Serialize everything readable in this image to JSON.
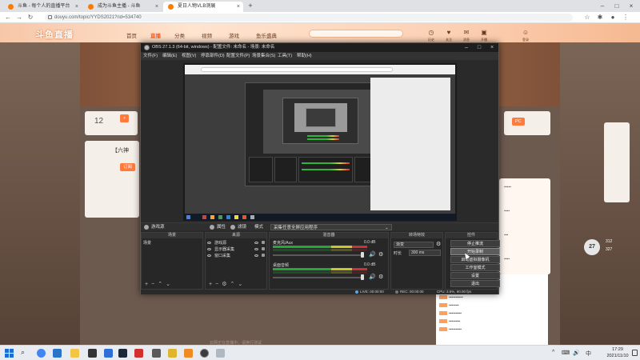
{
  "browser": {
    "tabs": [
      {
        "label": "斗鱼 - 每个人的直播平台"
      },
      {
        "label": "成为斗鱼主播 - 斗鱼"
      },
      {
        "label": "夏日人物VLB测展"
      }
    ],
    "url": "douyu.com/topic/YYDS2021?rid=534740"
  },
  "site": {
    "logo": "斗鱼直播",
    "nav": [
      "首页",
      "直播",
      "分类",
      "视频",
      "游戏",
      "鱼乐盛典"
    ],
    "header_icons": [
      "历史",
      "关注",
      "消息",
      "开播",
      "登录"
    ]
  },
  "page": {
    "streamer_count": "12",
    "streamer_name": "【六神",
    "left_chip": "订阅",
    "side_number": "27",
    "side_stats": [
      "312",
      "327"
    ],
    "below_obs_text": "云网正在直播中，请换行测试"
  },
  "obs": {
    "title": "OBS 27.1.3 (64-bit, windows) - 配置文件: 未命名 - 场景: 未命名",
    "menu": [
      "文件(F)",
      "编辑(E)",
      "视图(V)",
      "停靠部件(D)",
      "配置文件(P)",
      "场景集合(S)",
      "工具(T)",
      "帮助(H)"
    ],
    "scenebar": {
      "source_label": "游戏源",
      "properties": "属性",
      "filters": "滤镜",
      "mode_label": "模式",
      "mode_value": "采集任意全屏应用程序"
    },
    "docks": {
      "scenes": {
        "title": "场景",
        "items": [
          "场景"
        ]
      },
      "sources": {
        "title": "来源",
        "items": [
          "游戏源",
          "显示器采集",
          "窗口采集"
        ]
      },
      "mixer": {
        "title": "混音器",
        "channels": [
          {
            "name": "麦克风/Aux",
            "db": "0.0 dB"
          },
          {
            "name": "桌面音频",
            "db": "0.0 dB"
          }
        ]
      },
      "transitions": {
        "title": "转场特效",
        "type": "渐变",
        "duration_label": "时长",
        "duration": "300 ms"
      },
      "controls": {
        "title": "控件",
        "buttons": [
          "停止推流",
          "开始录制",
          "启动虚拟摄像机",
          "工作室模式",
          "设置",
          "退出"
        ],
        "active_index": 1
      }
    },
    "status": {
      "live": "LIVE: 00:00:00",
      "rec": "REC: 00:00:00",
      "cpu": "CPU: 3.5%, 60.00 fps"
    }
  },
  "taskbar": {
    "time": "17:29",
    "date": "2021/11/10",
    "tray": [
      "^",
      "⌨",
      "🔊",
      "中"
    ]
  },
  "colors": {
    "accent": "#ff7a3c",
    "obs_bg": "#2a2a2a",
    "meter_green": "#27a63a",
    "meter_yellow": "#c9c82a",
    "meter_red": "#c63434"
  }
}
